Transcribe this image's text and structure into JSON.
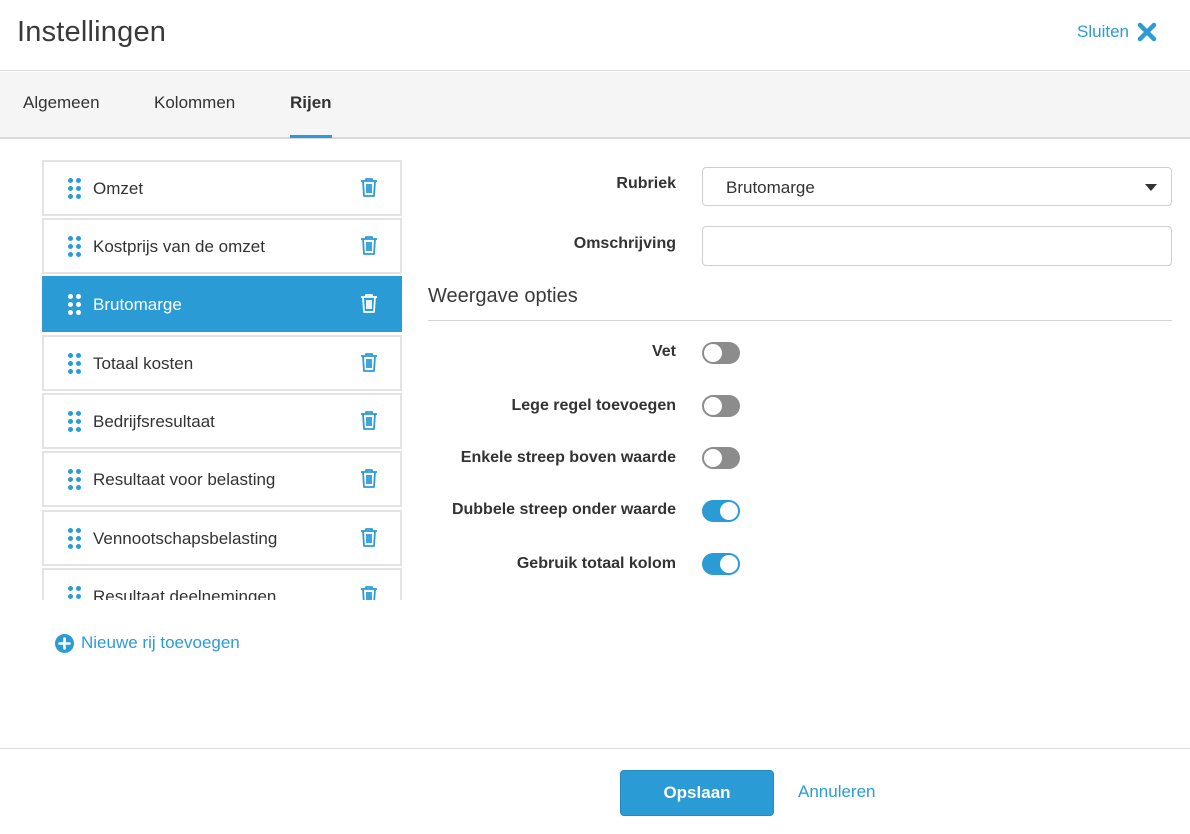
{
  "window": {
    "title": "Instellingen",
    "close_label": "Sluiten"
  },
  "tabs": [
    {
      "label": "Algemeen",
      "active": false
    },
    {
      "label": "Kolommen",
      "active": false
    },
    {
      "label": "Rijen",
      "active": true
    }
  ],
  "rows": [
    {
      "label": "Omzet",
      "selected": false
    },
    {
      "label": "Kostprijs van de omzet",
      "selected": false
    },
    {
      "label": "Brutomarge",
      "selected": true
    },
    {
      "label": "Totaal kosten",
      "selected": false
    },
    {
      "label": "Bedrijfsresultaat",
      "selected": false
    },
    {
      "label": "Resultaat voor belasting",
      "selected": false
    },
    {
      "label": "Vennootschapsbelasting",
      "selected": false
    },
    {
      "label": "Resultaat deelnemingen",
      "selected": false
    }
  ],
  "add_row_label": "Nieuwe rij toevoegen",
  "form": {
    "rubriek_label": "Rubriek",
    "rubriek_value": "Brutomarge",
    "omschrijving_label": "Omschrijving",
    "omschrijving_value": ""
  },
  "display_options": {
    "title": "Weergave opties",
    "options": [
      {
        "label": "Vet",
        "on": false
      },
      {
        "label": "Lege regel toevoegen",
        "on": false
      },
      {
        "label": "Enkele streep boven waarde",
        "on": false
      },
      {
        "label": "Dubbele streep onder waarde",
        "on": true
      },
      {
        "label": "Gebruik totaal kolom",
        "on": true
      }
    ]
  },
  "footer": {
    "save_label": "Opslaan",
    "cancel_label": "Annuleren"
  },
  "colors": {
    "accent": "#2b9bd6",
    "toggle_off": "#8c8c8c",
    "border": "#e3e3e3"
  },
  "icons": {
    "close": "close-x-icon",
    "drag": "drag-handle-icon",
    "delete": "trash-icon",
    "add": "plus-circle-icon",
    "dropdown": "caret-down-icon"
  }
}
